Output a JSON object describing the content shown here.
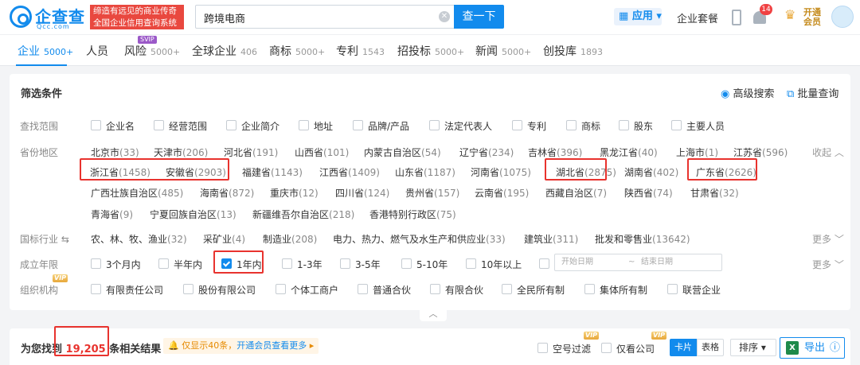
{
  "header": {
    "logo_text": "企查查",
    "logo_sub": "Qcc.com",
    "slogan_line1": "缔造有远见的商业传奇",
    "slogan_line2": "全国企业信用查询系统",
    "search_value": "跨境电商",
    "search_button": "查一下",
    "app_menu": "应用",
    "enterprise_pkg": "企业套餐",
    "notification_count": "14",
    "vip_line1": "开通",
    "vip_line2": "会员"
  },
  "tabs": [
    {
      "label": "企业",
      "count": "5000+"
    },
    {
      "label": "人员",
      "count": ""
    },
    {
      "label": "风险",
      "count": "5000+",
      "badge": "SVIP"
    },
    {
      "label": "全球企业",
      "count": "406"
    },
    {
      "label": "商标",
      "count": "5000+"
    },
    {
      "label": "专利",
      "count": "1543"
    },
    {
      "label": "招投标",
      "count": "5000+"
    },
    {
      "label": "新闻",
      "count": "5000+"
    },
    {
      "label": "创投库",
      "count": "1893"
    }
  ],
  "filter": {
    "title": "筛选条件",
    "advanced_search": "高级搜索",
    "batch_query": "批量查询",
    "scope": {
      "label": "查找范围",
      "options": [
        "企业名",
        "经营范围",
        "企业简介",
        "地址",
        "品牌/产品",
        "法定代表人",
        "专利",
        "商标",
        "股东",
        "主要人员"
      ]
    },
    "province": {
      "label": "省份地区",
      "collapse": "收起",
      "items": [
        {
          "name": "北京市",
          "n": "(33)"
        },
        {
          "name": "天津市",
          "n": "(206)"
        },
        {
          "name": "河北省",
          "n": "(191)"
        },
        {
          "name": "山西省",
          "n": "(101)"
        },
        {
          "name": "内蒙古自治区",
          "n": "(54)"
        },
        {
          "name": "辽宁省",
          "n": "(234)"
        },
        {
          "name": "吉林省",
          "n": "(396)"
        },
        {
          "name": "黑龙江省",
          "n": "(40)"
        },
        {
          "name": "上海市",
          "n": "(1)"
        },
        {
          "name": "江苏省",
          "n": "(596)"
        },
        {
          "name": "浙江省",
          "n": "(1458)"
        },
        {
          "name": "安徽省",
          "n": "(2903)"
        },
        {
          "name": "福建省",
          "n": "(1143)"
        },
        {
          "name": "江西省",
          "n": "(1409)"
        },
        {
          "name": "山东省",
          "n": "(1187)"
        },
        {
          "name": "河南省",
          "n": "(1075)"
        },
        {
          "name": "湖北省",
          "n": "(2875)"
        },
        {
          "name": "湖南省",
          "n": "(402)"
        },
        {
          "name": "广东省",
          "n": "(2626)"
        },
        {
          "name": "广西壮族自治区",
          "n": "(485)"
        },
        {
          "name": "海南省",
          "n": "(872)"
        },
        {
          "name": "重庆市",
          "n": "(12)"
        },
        {
          "name": "四川省",
          "n": "(124)"
        },
        {
          "name": "贵州省",
          "n": "(157)"
        },
        {
          "name": "云南省",
          "n": "(195)"
        },
        {
          "name": "西藏自治区",
          "n": "(7)"
        },
        {
          "name": "陕西省",
          "n": "(74)"
        },
        {
          "name": "甘肃省",
          "n": "(32)"
        },
        {
          "name": "青海省",
          "n": "(9)"
        },
        {
          "name": "宁夏回族自治区",
          "n": "(13)"
        },
        {
          "name": "新疆维吾尔自治区",
          "n": "(218)"
        },
        {
          "name": "香港特别行政区",
          "n": "(75)"
        }
      ]
    },
    "industry": {
      "label": "国标行业",
      "more": "更多",
      "items": [
        {
          "name": "农、林、牧、渔业",
          "n": "(32)"
        },
        {
          "name": "采矿业",
          "n": "(4)"
        },
        {
          "name": "制造业",
          "n": "(208)"
        },
        {
          "name": "电力、热力、燃气及水生产和供应业",
          "n": "(33)"
        },
        {
          "name": "建筑业",
          "n": "(311)"
        },
        {
          "name": "批发和零售业",
          "n": "(13642)"
        }
      ]
    },
    "founded": {
      "label": "成立年限",
      "options": [
        "3个月内",
        "半年内",
        "1年内",
        "1-3年",
        "3-5年",
        "5-10年",
        "10年以上"
      ],
      "checked": "1年内",
      "start_placeholder": "开始日期",
      "sep": "~",
      "end_placeholder": "结束日期",
      "more": "更多"
    },
    "org": {
      "label": "组织机构",
      "vip": "VIP",
      "options": [
        "有限责任公司",
        "股份有限公司",
        "个体工商户",
        "普通合伙",
        "有限合伙",
        "全民所有制",
        "集体所有制",
        "联营企业"
      ]
    }
  },
  "results": {
    "prefix": "为您找到",
    "count": "19,205",
    "suffix": "条相关结果",
    "notice": "仅显示40条，",
    "notice_link": "开通会员查看更多",
    "empty_filter": "空号过滤",
    "only_company": "仅看公司",
    "vip": "VIP",
    "card": "卡片",
    "table": "表格",
    "sort": "排序",
    "export": "导出"
  }
}
